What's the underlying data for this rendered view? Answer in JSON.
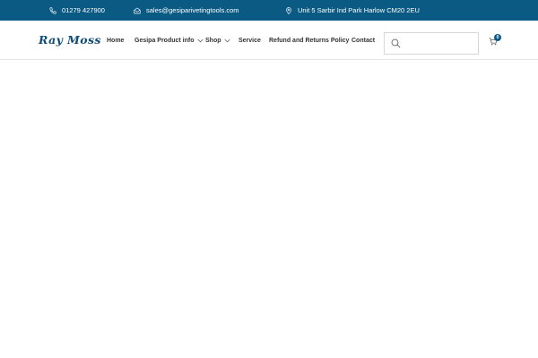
{
  "topbar": {
    "phone": "01279 427900",
    "email": "sales@gesiparivetingtools.com",
    "address": "Unit 5 Sarbir Ind Park Harlow CM20 2EU",
    "icons": {
      "phone": "phone-icon",
      "email": "envelope-icon",
      "address": "location-pin-icon"
    },
    "background_color": "#0b5a83"
  },
  "header": {
    "logo": "Ray Moss",
    "logo_color": "#0e4c78"
  },
  "nav": {
    "home": "Home",
    "gesipa": "Gesipa Product info",
    "shop": "Shop",
    "service": "Service",
    "refund": "Refund and Returns Policy",
    "contact": "Contact"
  },
  "search": {
    "placeholder": "",
    "value": "",
    "icon": "search-icon"
  },
  "cart": {
    "count": "0",
    "icon": "cart-icon"
  }
}
